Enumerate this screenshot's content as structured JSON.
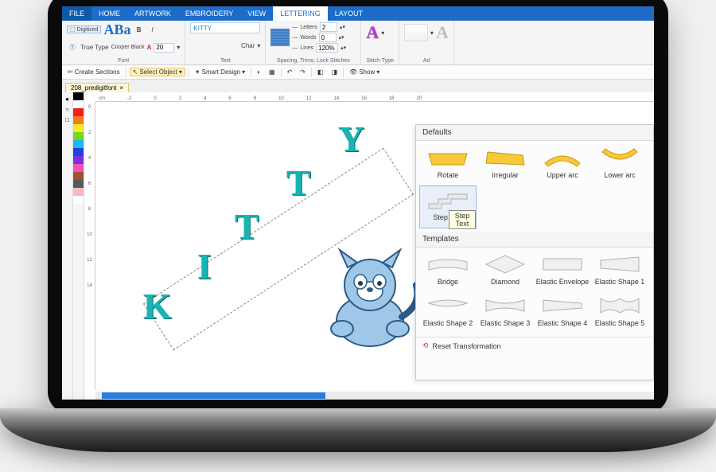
{
  "tabs": {
    "file": "FILE",
    "home": "HOME",
    "artwork": "ARTWORK",
    "embroidery": "EMBROIDERY",
    "view": "VIEW",
    "lettering": "LETTERING",
    "layout": "LAYOUT"
  },
  "ribbon": {
    "digitized": "Digitized",
    "truetype": "True Type",
    "aba_sample": "ABa",
    "font_name": "Cooper Black",
    "font_group": "Font",
    "bold": "B",
    "italic": "I",
    "size": "20",
    "text_input": "KITTY",
    "char": "Char",
    "text_group": "Text",
    "letters_lbl": "Letters",
    "letters_val": "2",
    "words_lbl": "Words",
    "words_val": "0",
    "lines_lbl": "Lines",
    "lines_val": "120%",
    "spacing_group": "Spacing, Trims, Lock Stitches",
    "stitch_group": "Stitch Type",
    "adv_group": "Ad"
  },
  "qbar": {
    "create_sections": "Create Sections",
    "select_object": "Select Object",
    "smart_design": "Smart Design",
    "show": "Show"
  },
  "doc_tab": "208_predigitfont",
  "ruler_unit": "cm",
  "hruler": [
    "-2",
    "0",
    "2",
    "4",
    "6",
    "8",
    "10",
    "12",
    "14",
    "16",
    "18",
    "20"
  ],
  "vruler": [
    "0",
    "2",
    "4",
    "6",
    "8",
    "10",
    "12",
    "14"
  ],
  "canvas_text": "KITTY",
  "panel": {
    "defaults_title": "Defaults",
    "templates_title": "Templates",
    "defaults": [
      "Rotate",
      "Irregular",
      "Upper arc",
      "Lower arc"
    ],
    "step_text": "Step Text",
    "tooltip": "Step Text",
    "templates": [
      "Bridge",
      "Diamond",
      "Elastic Envelope",
      "Elastic Shape 1",
      "Elastic Shape 2",
      "Elastic Shape 3",
      "Elastic Shape 4",
      "Elastic Shape 5"
    ],
    "reset": "Reset Transformation"
  },
  "palette": [
    "#000000",
    "#ffffff",
    "#f02020",
    "#f87820",
    "#f8e820",
    "#70d820",
    "#20b8f0",
    "#2040e0",
    "#8030d8",
    "#f050c0",
    "#a05030",
    "#585858",
    "#f8b8c0",
    "#ffffff"
  ]
}
